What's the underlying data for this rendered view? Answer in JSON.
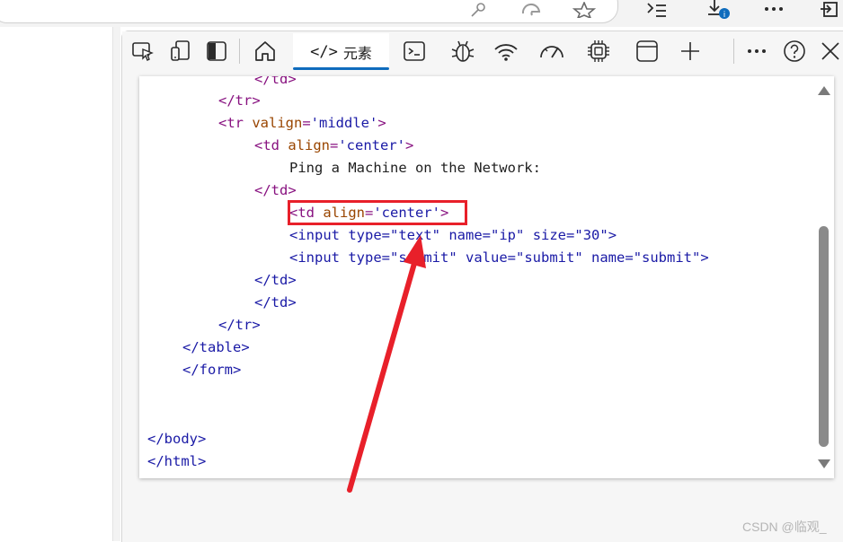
{
  "devtools": {
    "elements_tab_label": "元素",
    "elements_tab_glyph": "</>"
  },
  "code_lines": [
    "</td>",
    "</tr>",
    "<tr valign='middle'>",
    "<td align='center'>",
    "Ping a Machine on the Network:",
    "</td>",
    "<td align='center'>",
    "<input type=\"text\" name=\"ip\" size=\"30\">",
    "<input type=\"submit\" value=\"submit\" name=\"submit\">",
    "</td>",
    "</td>",
    "</tr>",
    "</table>",
    "</form>",
    "</body>",
    "</html>"
  ],
  "code": {
    "l0": "</td>",
    "l1": "</tr>",
    "l2_open": "<tr ",
    "l2_attr": "valign",
    "l2_eq": "=",
    "l2_val": "'middle'",
    "l2_close": ">",
    "l3_open": "<td ",
    "l3_attr": "align",
    "l3_eq": "=",
    "l3_val": "'center'",
    "l3_close": ">",
    "l4_text": "Ping a Machine on the Network:",
    "l5": "</td>",
    "l6_open": "<td ",
    "l6_attr": "align",
    "l6_eq": "=",
    "l6_val": "'center'",
    "l6_close": ">",
    "l7_open": "<input ",
    "l7_a1": "type",
    "l7_v1": "\"text\"",
    "l7_a2": "name",
    "l7_v2": "\"ip\"",
    "l7_a3": "size",
    "l7_v3": "\"30\"",
    "l7_close": ">",
    "l8_open": "<input ",
    "l8_a1": "type",
    "l8_v1": "\"submit\"",
    "l8_a2": "value",
    "l8_v2": "\"submit\"",
    "l8_a3": "name",
    "l8_v3": "\"submit\"",
    "l8_close": ">",
    "l9": "</td>",
    "l10": "</td>",
    "l11": "</tr>",
    "l12": "</table>",
    "l13": "</form>",
    "l14": "</body>",
    "l15": "</html>"
  },
  "watermark": "CSDN @临观_",
  "colors": {
    "highlight": "#e8202a",
    "tab_underline": "#0f6cbd",
    "tag": "#881280",
    "attr_name": "#994500",
    "attr_value": "#1a1aa6"
  }
}
